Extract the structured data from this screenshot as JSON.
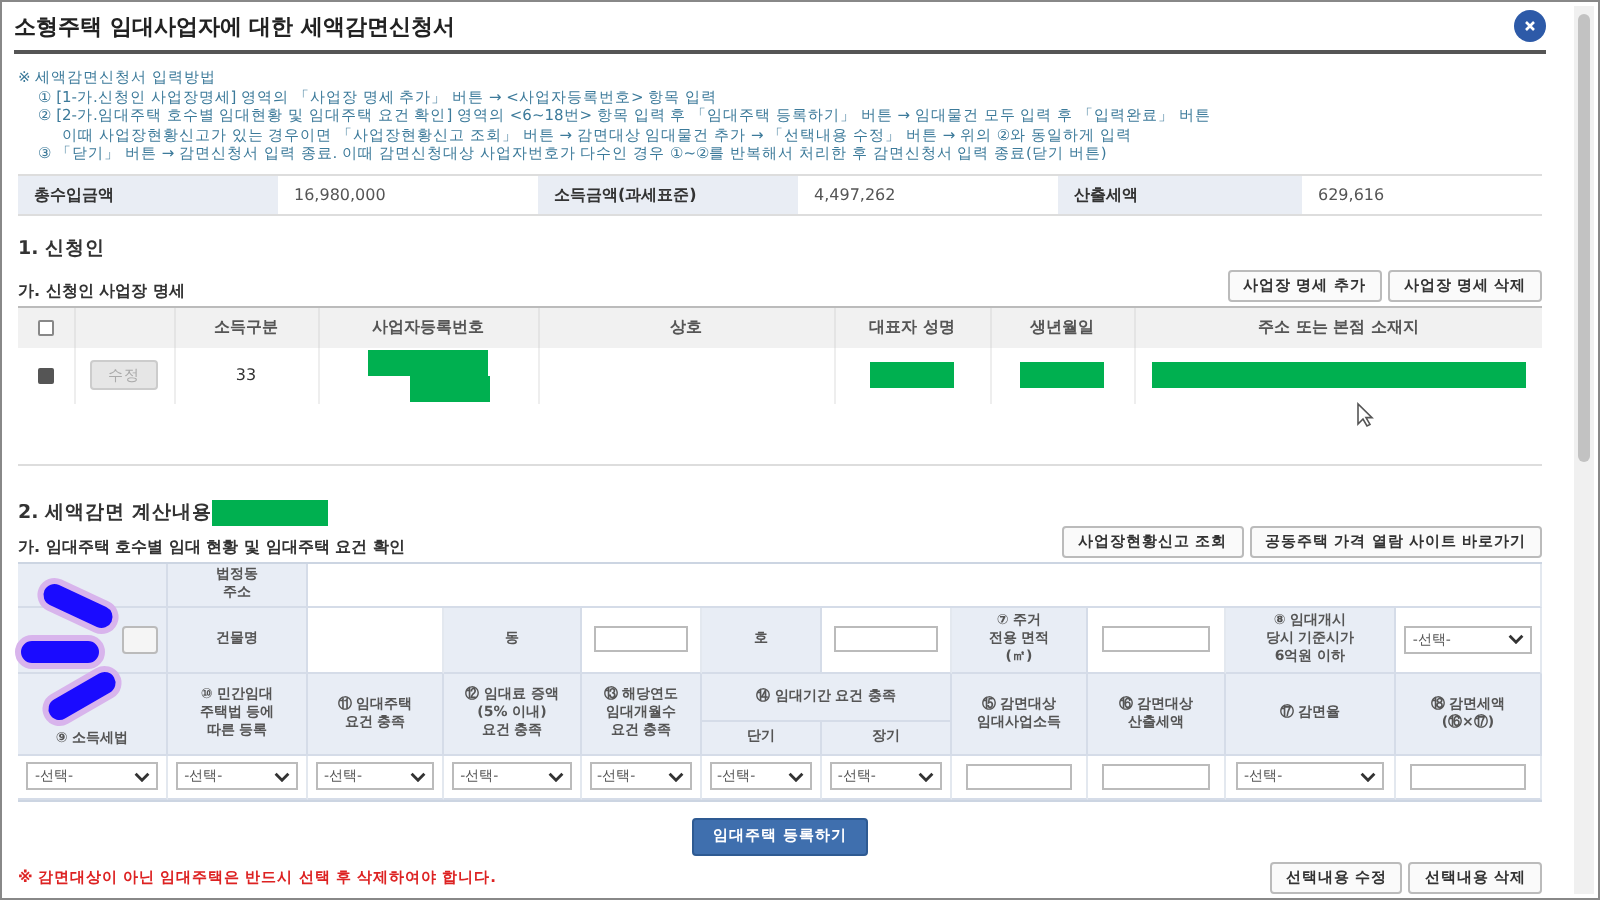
{
  "window": {
    "title": "소형주택 임대사업자에 대한 세액감면신청서"
  },
  "instructions": {
    "heading": "※ 세액감면신청서 입력방법",
    "steps": [
      "① [1-가.신청인 사업장명세] 영역의 「사업장 명세 추가」 버튼 → <사업자등록번호> 항목 입력",
      "② [2-가.임대주택 호수별 임대현황 및 임대주택 요건 확인] 영역의 <6~18번> 항목 입력 후 「임대주택 등록하기」 버튼 → 임대물건 모두 입력 후 「입력완료」 버튼",
      "이때 사업장현황신고가 있는 경우이면 「사업장현황신고 조회」 버튼 → 감면대상 임대물건 추가 → 「선택내용 수정」 버튼 → 위의 ②와 동일하게 입력",
      "③ 「닫기」 버튼 → 감면신청서 입력 종료. 이때 감면신청대상 사업자번호가 다수인 경우 ①~②를 반복해서 처리한 후 감면신청서 입력 종료(닫기 버튼)"
    ]
  },
  "summary": [
    {
      "label": "총수입금액",
      "value": "16,980,000"
    },
    {
      "label": "소득금액(과세표준)",
      "value": "4,497,262"
    },
    {
      "label": "산출세액",
      "value": "629,616"
    }
  ],
  "section1": {
    "title": "1. 신청인",
    "subtitle": "가. 신청인 사업장 명세",
    "buttons": [
      "사업장 명세 추가",
      "사업장 명세 삭제"
    ],
    "table": {
      "header_checked": false,
      "columns": [
        "소득구분",
        "사업자등록번호",
        "상호",
        "대표자 성명",
        "생년월일",
        "주소 또는 본점 소재지"
      ],
      "rows": [
        {
          "checked": true,
          "edit_button": {
            "label": "수정",
            "disabled": true
          },
          "income_type": "33"
        }
      ]
    }
  },
  "section2": {
    "title": "2. 세액감면 계산내용",
    "subtitle": "가. 임대주택 호수별 임대 현황 및 임대주택 요건 확인",
    "buttons": [
      "사업장현황신고 조회",
      "공동주택 가격 열람 사이트 바로가기"
    ],
    "address": {
      "road_label": "법정동\n주소",
      "building_label": "건물명",
      "dong_label": "동",
      "ho_label": "호",
      "area_label": "⑦ 주거\n전용 면적\n(㎡)",
      "price_label": "⑧ 임대개시\n당시 기준시가\n6억원 이하",
      "price_select": "-선택-"
    },
    "requirements": [
      {
        "kind": "select",
        "label": "⑨ 소득세법",
        "value": "-선택-"
      },
      {
        "kind": "select",
        "label": "⑩ 민간임대\n주택법 등에\n따른 등록",
        "value": "-선택-"
      },
      {
        "kind": "select",
        "label": "⑪ 임대주택\n요건 충족",
        "value": "-선택-"
      },
      {
        "kind": "select",
        "label": "⑫ 임대료 증액\n(5% 이내)\n요건 충족",
        "value": "-선택-"
      },
      {
        "kind": "select",
        "label": "⑬ 해당연도\n임대개월수\n요건 충족",
        "value": "-선택-"
      },
      {
        "kind": "split",
        "label": "⑭ 임대기간 요건 충족",
        "parts": [
          {
            "label": "단기",
            "value": "-선택-"
          },
          {
            "label": "장기",
            "value": "-선택-"
          }
        ]
      },
      {
        "kind": "input",
        "label": "⑮ 감면대상\n임대사업소득"
      },
      {
        "kind": "input",
        "label": "⑯ 감면대상\n산출세액"
      },
      {
        "kind": "select",
        "label": "⑰ 감면율",
        "value": "-선택-"
      },
      {
        "kind": "input",
        "label": "⑱ 감면세액\n(⑯×⑰)"
      }
    ],
    "register_button": "임대주택 등록하기",
    "notice": "※ 감면대상이 아닌 임대주택은 반드시 선택 후 삭제하여야 합니다.",
    "bottom_buttons": [
      "선택내용 수정",
      "선택내용 삭제"
    ]
  }
}
